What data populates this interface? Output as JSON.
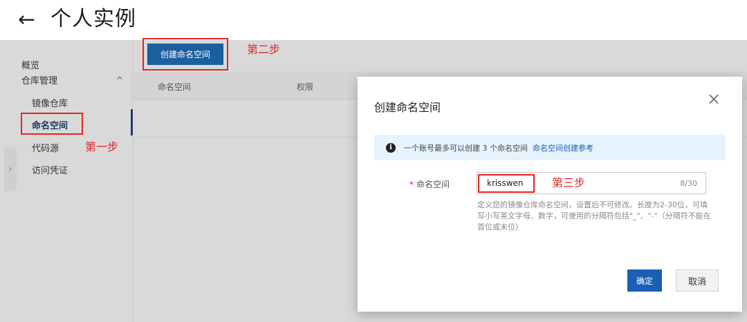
{
  "header": {
    "back_icon": "arrow-left-icon",
    "title": "个人实例"
  },
  "sidebar": {
    "overview": "概览",
    "group_label": "仓库管理",
    "group_caret": "^",
    "items": [
      {
        "label": "镜像仓库"
      },
      {
        "label": "命名空间"
      },
      {
        "label": "代码源"
      },
      {
        "label": "访问凭证"
      }
    ],
    "collapse_icon": "chevron-right-icon",
    "collapse_glyph": "›"
  },
  "main": {
    "create_button": "创建命名空间",
    "table": {
      "columns": [
        "命名空间",
        "权限"
      ]
    }
  },
  "annotations": {
    "step1": "第一步",
    "step2": "第二步",
    "step3": "第三步",
    "color": "#e02424"
  },
  "modal": {
    "title": "创建命名空间",
    "close_glyph": "×",
    "notice": {
      "icon_glyph": "i",
      "text": "一个账号最多可以创建 3 个命名空间",
      "link": "命名空间创建参考"
    },
    "field": {
      "required_mark": "*",
      "label": "命名空间",
      "value": "krisswen",
      "counter": "8/30",
      "help": "定义您的镜像仓库命名空间，设置后不可修改。长度为2-30位，可填写小写英文字母、数字，可使用的分隔符包括\"_\"、\"-\"（分隔符不能在首位或末位）"
    },
    "ok_button": "确定",
    "cancel_button": "取消"
  },
  "colors": {
    "primary": "#1b5fb4",
    "dim_overlay": "#d9d9d9",
    "notice_bg": "#e6f3fd"
  }
}
